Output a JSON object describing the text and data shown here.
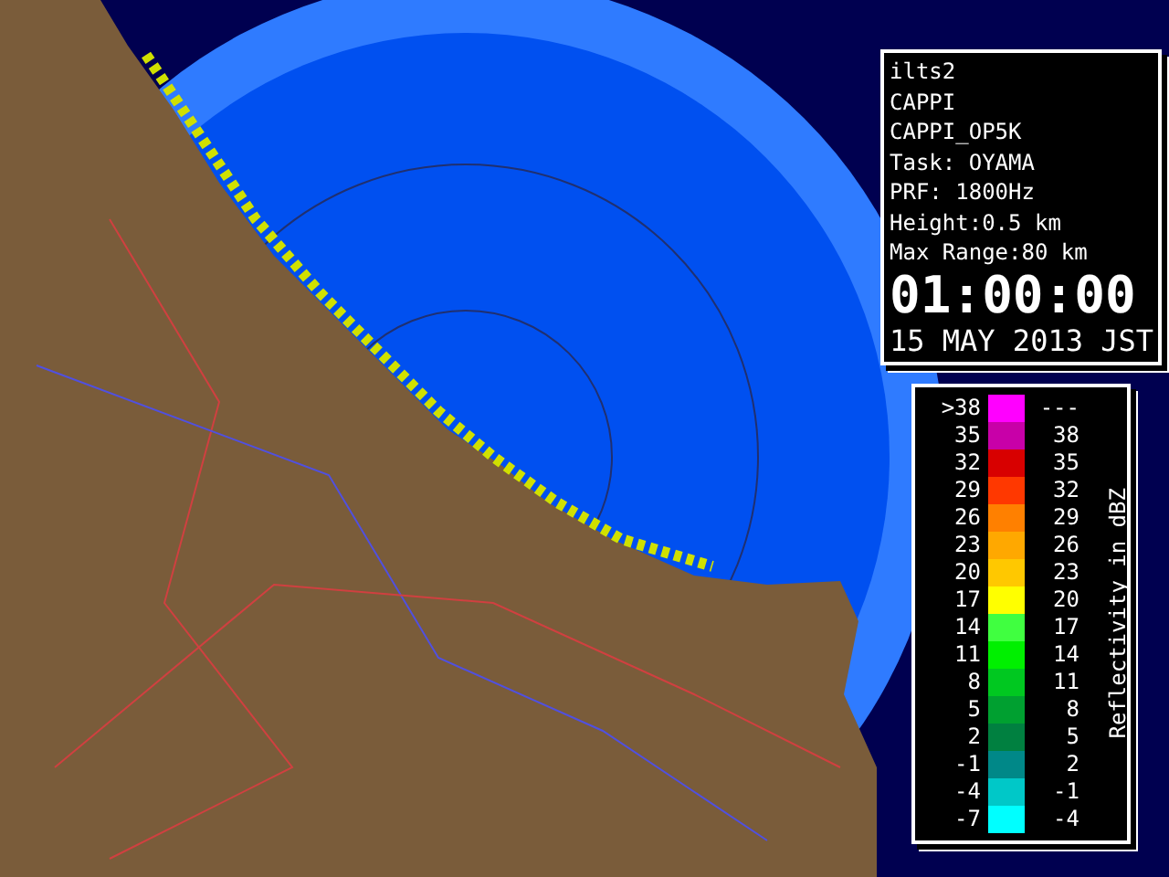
{
  "info_panel": {
    "lines": [
      "ilts2",
      "CAPPI",
      "CAPPI_OP5K",
      "Task: OYAMA",
      "PRF: 1800Hz",
      "Height:0.5 km",
      "Max Range:80 km"
    ],
    "time": "01:00:00",
    "date": "15 MAY 2013 JST"
  },
  "legend": {
    "title": "Reflectivity in dBZ",
    "rows": [
      {
        "low": ">38",
        "high": "---",
        "color": "#ff00ff"
      },
      {
        "low": "35",
        "high": "38",
        "color": "#c800a8"
      },
      {
        "low": "32",
        "high": "35",
        "color": "#d80000"
      },
      {
        "low": "29",
        "high": "32",
        "color": "#ff3800"
      },
      {
        "low": "26",
        "high": "29",
        "color": "#ff8000"
      },
      {
        "low": "23",
        "high": "26",
        "color": "#ffa800"
      },
      {
        "low": "20",
        "high": "23",
        "color": "#ffc800"
      },
      {
        "low": "17",
        "high": "20",
        "color": "#ffff00"
      },
      {
        "low": "14",
        "high": "17",
        "color": "#40ff40"
      },
      {
        "low": "11",
        "high": "14",
        "color": "#00f000"
      },
      {
        "low": "8",
        "high": "11",
        "color": "#00c820"
      },
      {
        "low": "5",
        "high": "8",
        "color": "#00a030"
      },
      {
        "low": "2",
        "high": "5",
        "color": "#008040"
      },
      {
        "low": "-1",
        "high": "2",
        "color": "#008888"
      },
      {
        "low": "-4",
        "high": "-1",
        "color": "#00c8c8"
      },
      {
        "low": "-7",
        "high": "-4",
        "color": "#00ffff"
      }
    ]
  }
}
